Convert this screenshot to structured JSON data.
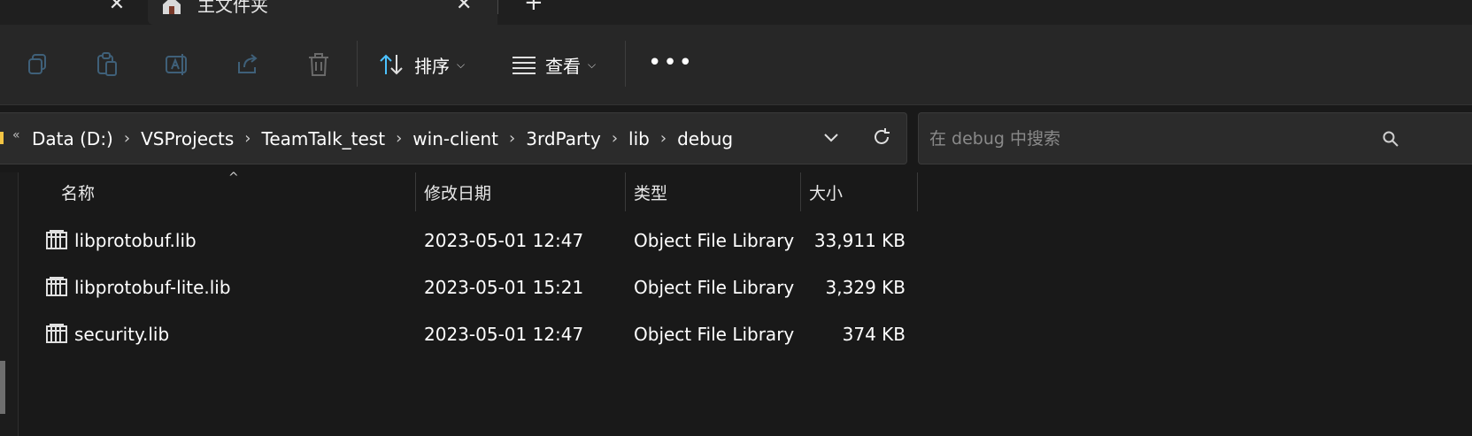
{
  "tabs": {
    "active_title": "主文件夹",
    "close_glyph": "✕",
    "new_glyph": "+"
  },
  "toolbar": {
    "sort_label": "排序",
    "view_label": "查看",
    "more_label": "•••",
    "chevron": "⌵"
  },
  "address": {
    "crumbs": [
      "Data (D:)",
      "VSProjects",
      "TeamTalk_test",
      "win-client",
      "3rdParty",
      "lib",
      "debug"
    ],
    "separator": "›",
    "overflow": "«"
  },
  "search": {
    "placeholder": "在 debug 中搜索"
  },
  "list": {
    "columns": [
      "名称",
      "修改日期",
      "类型",
      "大小"
    ],
    "rows": [
      {
        "name": "libprotobuf.lib",
        "date": "2023-05-01 12:47",
        "type": "Object File Library",
        "size": "33,911 KB"
      },
      {
        "name": "libprotobuf-lite.lib",
        "date": "2023-05-01 15:21",
        "type": "Object File Library",
        "size": "3,329 KB"
      },
      {
        "name": "security.lib",
        "date": "2023-05-01 12:47",
        "type": "Object File Library",
        "size": "374 KB"
      }
    ]
  },
  "icons": {
    "copy": "copy-icon",
    "paste": "paste-icon",
    "rename": "rename-icon",
    "share": "share-icon",
    "delete": "delete-icon",
    "sort": "sort-icon",
    "view": "view-icon",
    "home": "home-icon",
    "file": "library-file-icon",
    "refresh": "refresh-icon",
    "dropdown": "chevron-down-icon",
    "search": "search-icon"
  },
  "colors": {
    "accent": "#4cc2ff",
    "folder": "#f2c444",
    "background": "#191919"
  }
}
